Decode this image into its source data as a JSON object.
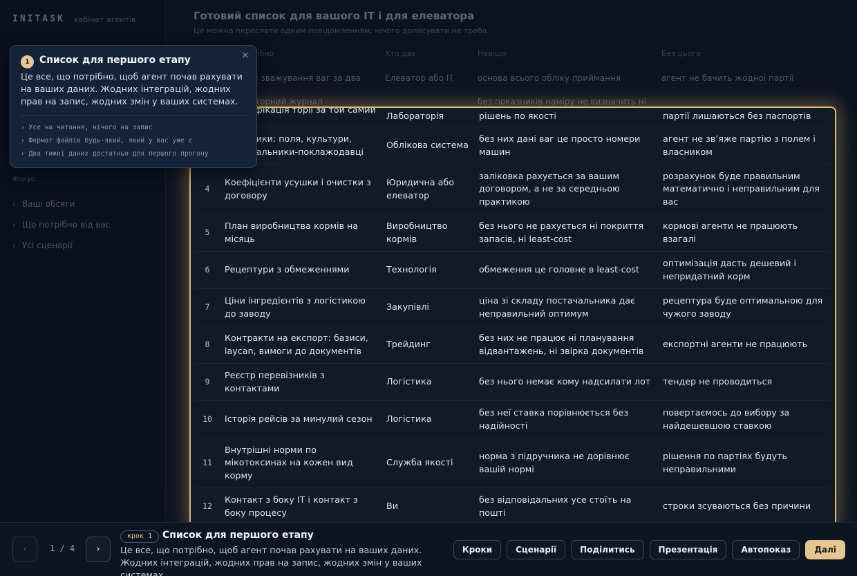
{
  "sidebar": {
    "brand": "INITASK",
    "brand_sub": "кабінет агентів",
    "section_label": "Фокус",
    "items": [
      {
        "label": "Ваші обсяги"
      },
      {
        "label": "Що потрібно від вас"
      },
      {
        "label": "Усі сценарії"
      }
    ]
  },
  "main": {
    "title": "Готовий список для вашого IT і для елеватора",
    "subtitle": "Це можна переслати одним повідомленням, нічого дописувати не треба.",
    "columns": [
      "Що потрібно",
      "Хто дає",
      "Навіщо",
      "Без цього"
    ],
    "dim_rows": [
      {
        "c1": "Журнал зважування ваг за два тижні",
        "c2": "Елеватор або IT",
        "c3": "основа всього обліку приймання",
        "c4": "агент не бачить жодної партії"
      },
      {
        "c1": "Лабораторний журнал",
        "c3": "без показників наміру не визначить ні"
      }
    ]
  },
  "table": {
    "rows": [
      {
        "num": "",
        "c1": "ідентифікація торії за той самий період",
        "c2": "Лабораторія",
        "c3": "рішень по якості",
        "c4": "партії лишаються без паспортів"
      },
      {
        "num": "",
        "c1": "Довідники: поля, культури, постачальники-поклажодавці",
        "c2": "Облікова система",
        "c3": "без них дані ваг це просто номери машин",
        "c4": "агент не зв’яже партію з полем і власником"
      },
      {
        "num": "4",
        "c1": "Коефіцієнти усушки і очистки з договору",
        "c2": "Юридична або елеватор",
        "c3": "заліковка рахується за вашим договором, а не за середньою практикою",
        "c4": "розрахунок буде правильним математично і неправильним для вас"
      },
      {
        "num": "5",
        "c1": "План виробництва кормів на місяць",
        "c2": "Виробництво кормів",
        "c3": "без нього не рахується ні покриття запасів, ні least-cost",
        "c4": "кормові агенти не працюють взагалі"
      },
      {
        "num": "6",
        "c1": "Рецептури з обмеженнями",
        "c2": "Технологія",
        "c3": "обмеження це головне в least-cost",
        "c4": "оптимізація дасть дешевий і непридатний корм"
      },
      {
        "num": "7",
        "c1": "Ціни інгредієнтів з логістикою до заводу",
        "c2": "Закупівлі",
        "c3": "ціна зі складу постачальника дає неправильний оптимум",
        "c4": "рецептура буде оптимальною для чужого заводу"
      },
      {
        "num": "8",
        "c1": "Контракти на експорт: базиси, laycan, вимоги до документів",
        "c2": "Трейдинг",
        "c3": "без них не працює ні планування відвантажень, ні звірка документів",
        "c4": "експортні агенти не працюють"
      },
      {
        "num": "9",
        "c1": "Реєстр перевізників з контактами",
        "c2": "Логістика",
        "c3": "без нього немає кому надсилати лот",
        "c4": "тендер не проводиться"
      },
      {
        "num": "10",
        "c1": "Історія рейсів за минулий сезон",
        "c2": "Логістика",
        "c3": "без неї ставка порівнюється без надійності",
        "c4": "повертаємось до вибору за найдешевшою ставкою"
      },
      {
        "num": "11",
        "c1": "Внутрішні норми по мікотоксинах на кожен вид корму",
        "c2": "Служба якості",
        "c3": "норма з підручника не дорівнює вашій нормі",
        "c4": "рішення по партіях будуть неправильними"
      },
      {
        "num": "12",
        "c1": "Контакт з боку IT і контакт з боку процесу",
        "c2": "Ви",
        "c3": "без відповідальних усе стоїть на пошті",
        "c4": "строки зсуваються без причини"
      }
    ]
  },
  "popup": {
    "step_number": "1",
    "title": "Список для першого етапу",
    "close_glyph": "×",
    "body": "Це все, що потрібно, щоб агент почав рахувати на ваших даних. Жодних інтеграцій, жодних прав на запис, жодних змін у ваших системах.",
    "bullets": [
      "› Усе на читання, нічого на запис",
      "› Формат файлів будь-який, який у вас уже є",
      "› Два тижні даних достатньо для першого прогону"
    ]
  },
  "bottom": {
    "prev_glyph": "‹",
    "next_glyph": "›",
    "counter": "1 / 4",
    "step_badge": "крок 1",
    "title": "Список для першого етапу",
    "description": "Це все, що потрібно, щоб агент почав рахувати на ваших даних. Жодних інтеграцій, жодних прав на запис, жодних змін у ваших системах.",
    "buttons": {
      "steps": "Кроки",
      "scenarios": "Сценарії",
      "share": "Поділитись",
      "presentation": "Презентація",
      "autoplay": "Автопоказ",
      "next": "Далі"
    }
  },
  "colors": {
    "accent": "#e6c68b",
    "background": "#0b1320",
    "popup_bg": "#15233a"
  }
}
